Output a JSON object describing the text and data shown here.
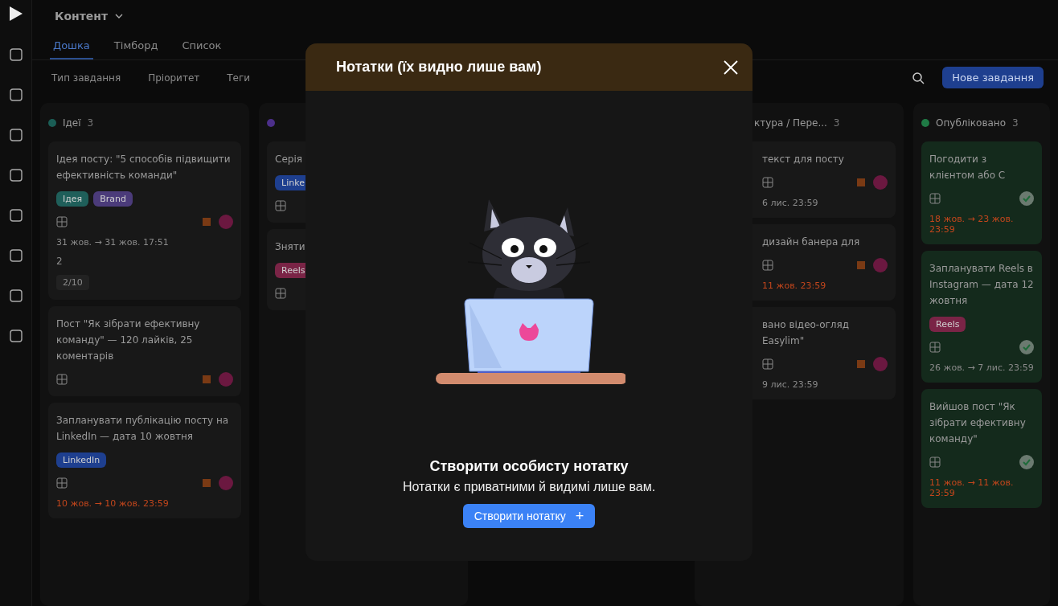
{
  "header": {
    "title": "Контент"
  },
  "tabs": [
    {
      "label": "Дошка",
      "selected": true
    },
    {
      "label": "Тімборд",
      "selected": false
    },
    {
      "label": "Список",
      "selected": false
    }
  ],
  "filters": [
    "Тип завдання",
    "Пріоритет",
    "Теги"
  ],
  "new_task_button": "Нове завдання",
  "columns": [
    {
      "title": "Ідеї",
      "count": "3",
      "color": "#1b5e56",
      "cards": [
        {
          "title": "Ідея посту: \"5 способів підвищити ефективність команди\"",
          "tags": [
            {
              "label": "Ідея",
              "color": "#1f5f5a"
            },
            {
              "label": "Brand",
              "color": "#4b3b7a"
            }
          ],
          "date": "31 жов. → 31 жов. 17:51",
          "overdue": false,
          "comments": "2",
          "subtasks": "2/10",
          "done": false
        },
        {
          "title": "Пост \"Як зібрати ефективну команду\" — 120 лайків, 25 коментарів",
          "done": false
        },
        {
          "title": "Запланувати публікацію посту на LinkedIn — дата 10 жовтня",
          "tags": [
            {
              "label": "LinkedIn",
              "color": "#1e3f8f"
            }
          ],
          "date": "10 жов. → 10 жов. 23:59",
          "overdue": true,
          "done": false
        }
      ]
    },
    {
      "color": "#4c2f8a",
      "cards": [
        {
          "title": "Серія",
          "tags": [
            {
              "label": "Linke",
              "color": "#1e3f8f"
            }
          ],
          "done": false
        },
        {
          "title": "Зняти",
          "tags": [
            {
              "label": "Reels",
              "color": "#7a2446"
            }
          ],
          "done": false
        }
      ]
    },
    {
      "title": "ктура / Пере...",
      "count": "3",
      "offset": true,
      "cards": [
        {
          "title": "текст для посту",
          "date": "6 лис. 23:59",
          "overdue": false,
          "done": false
        },
        {
          "title": "дизайн банера для",
          "date": "11 жов. 23:59",
          "overdue": true,
          "done": false
        },
        {
          "title": "вано відео-огляд Easylim\"",
          "date": "9 лис. 23:59",
          "overdue": false,
          "done": false
        }
      ]
    },
    {
      "title": "Опубліковано",
      "count": "3",
      "color": "#1f7a45",
      "cards": [
        {
          "title": "Погодити з клієнтом або С",
          "date": "18 жов. → 23 жов. 23:59",
          "overdue": true,
          "done": true
        },
        {
          "title": "Запланувати Reels в Instagram — дата 12 жовтня",
          "tags": [
            {
              "label": "Reels",
              "color": "#7a2446"
            }
          ],
          "date": "26 жов. → 7 лис. 23:59",
          "overdue": false,
          "done": true
        },
        {
          "title": "Вийшов пост \"Як зібрати ефективну команду\"",
          "date": "11 жов. → 11 жов. 23:59",
          "overdue": true,
          "done": true
        }
      ]
    }
  ],
  "modal": {
    "title": "Нотатки (їх видно лише вам)",
    "heading": "Створити особисту нотатку",
    "text": "Нотатки є приватними й видимі лише вам.",
    "button": "Створити нотатку",
    "button_icon": "+"
  }
}
